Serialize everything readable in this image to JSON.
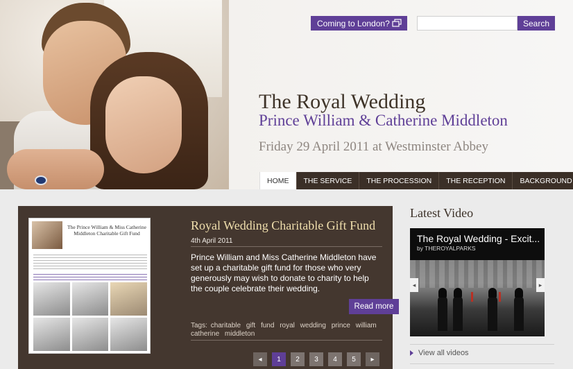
{
  "header": {
    "coming_btn": "Coming to London?",
    "search_placeholder": "",
    "search_btn": "Search",
    "title": "The Royal Wedding",
    "subtitle": "Prince William & Catherine Middleton",
    "date": "Friday 29 April 2011 at Westminster Abbey"
  },
  "nav": {
    "items": [
      {
        "label": "HOME",
        "active": true
      },
      {
        "label": "THE SERVICE"
      },
      {
        "label": "THE PROCESSION"
      },
      {
        "label": "THE RECEPTION"
      },
      {
        "label": "BACKGROUND"
      }
    ]
  },
  "feature": {
    "thumb_title": "The Prince William & Miss Catherine Middleton Charitable Gift Fund",
    "title": "Royal Wedding Charitable Gift Fund",
    "date": "4th April 2011",
    "body": "Prince William and Miss Catherine Middleton have set up a charitable gift fund for those who very generously may wish to donate to charity to help the couple celebrate their wedding.",
    "read_more": "Read more",
    "tags_label": "Tags:",
    "tags": [
      "charitable",
      "gift",
      "fund",
      "royal",
      "wedding",
      "prince",
      "william",
      "catherine",
      "middleton"
    ]
  },
  "pager": {
    "prev": "◂",
    "pages": [
      "1",
      "2",
      "3",
      "4",
      "5"
    ],
    "active_page": 1,
    "next": "▸"
  },
  "sidebar": {
    "heading": "Latest Video",
    "video_title": "The Royal Wedding - Excit...",
    "video_by": "by THEROYALPARKS",
    "links": [
      "View all videos"
    ]
  },
  "colors": {
    "accent": "#5f3f97",
    "feature_bg": "#44372f",
    "nav_bg": "#3b2f27",
    "feature_title": "#f0dfad"
  }
}
